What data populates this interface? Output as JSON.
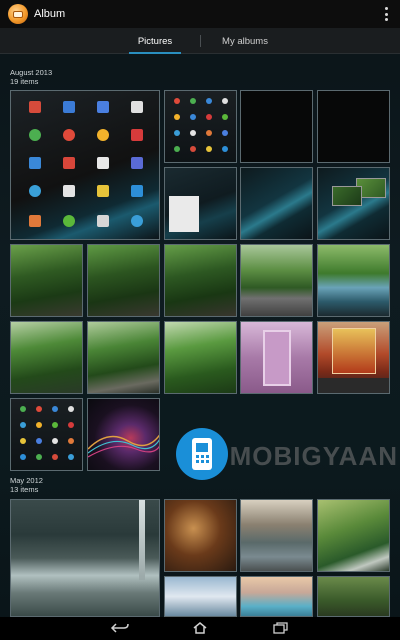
{
  "app": {
    "title": "Album",
    "icon": "album-icon",
    "menu_icon": "overflow-menu-icon"
  },
  "tabs": [
    {
      "label": "Pictures",
      "selected": true
    },
    {
      "label": "My albums",
      "selected": false
    }
  ],
  "sections": [
    {
      "date": "August 2013",
      "count": "19 items"
    },
    {
      "date": "May 2012",
      "count": "13 items"
    }
  ],
  "watermark": {
    "text": "MOBIGYAAN"
  },
  "nav": {
    "back_icon": "back-icon",
    "home_icon": "home-icon",
    "recent_icon": "recent-apps-icon"
  },
  "colors": {
    "accent": "#2a8fbf",
    "app_icon": "#f39a2b",
    "watermark_blue": "#1a8fd8"
  }
}
